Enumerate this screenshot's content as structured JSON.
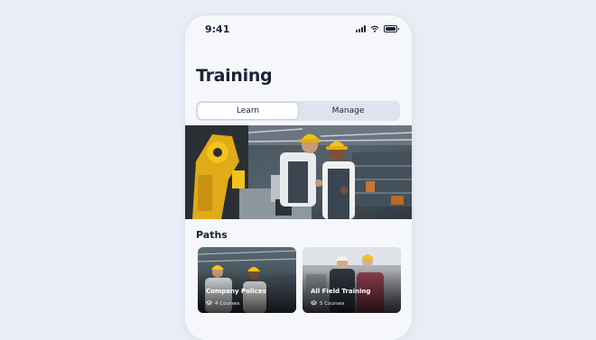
{
  "status_bar": {
    "time": "9:41"
  },
  "page": {
    "title": "Training"
  },
  "tabs": [
    {
      "label": "Learn",
      "active": true
    },
    {
      "label": "Manage",
      "active": false
    }
  ],
  "paths": {
    "heading": "Paths",
    "cards": [
      {
        "title": "Company Polices",
        "meta": "4 Courses",
        "icon": "layers-icon"
      },
      {
        "title": "All Field Training",
        "meta": "5 Courses",
        "icon": "layers-icon"
      }
    ]
  },
  "colors": {
    "background": "#e9edf6",
    "screen": "#f6f7fa",
    "text": "#1b2233",
    "segment_track": "#dfe3ee",
    "helmet_yellow": "#f2c318"
  }
}
